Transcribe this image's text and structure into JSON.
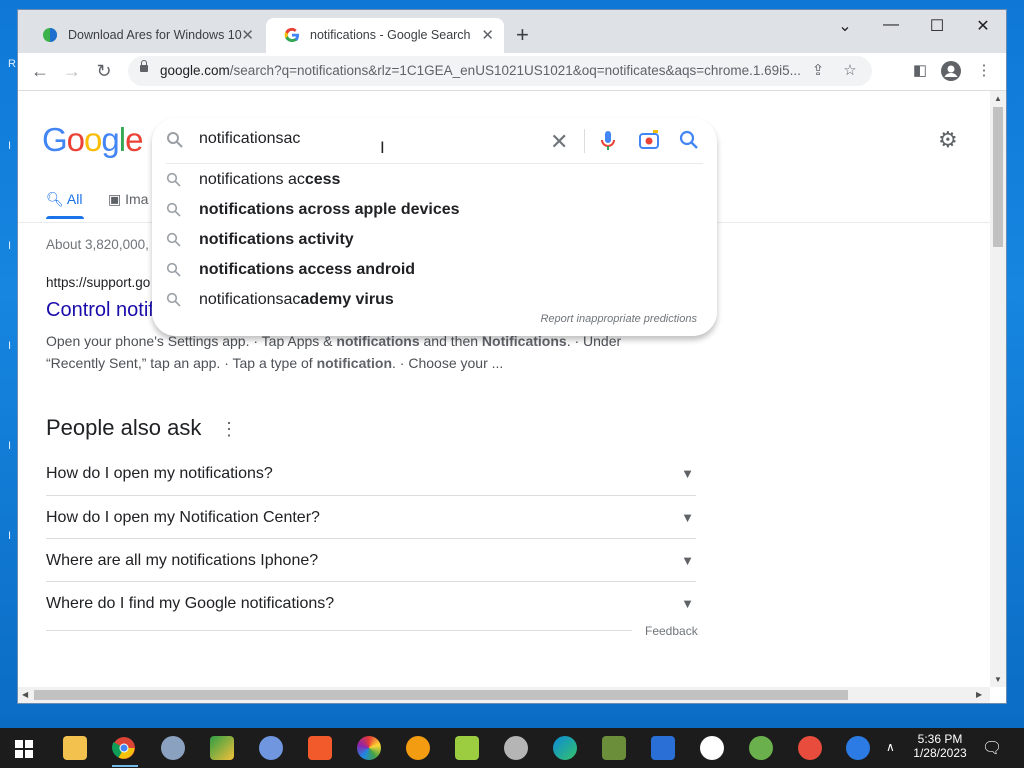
{
  "browser": {
    "tabs": [
      {
        "title": "Download Ares for Windows 10",
        "close": "✕"
      },
      {
        "title": "notifications - Google Search",
        "close": "✕"
      }
    ],
    "new_tab": "+",
    "url_host": "google.com",
    "url_rest": "/search?q=notifications&rlz=1C1GEA_enUS1021US1021&oq=notificates&aqs=chrome.1.69i5..."
  },
  "search": {
    "logo": "Google",
    "query": "notificationsac",
    "suggestions": [
      {
        "typed": "notifications ac",
        "completion": "cess"
      },
      {
        "typed": "",
        "completion": "notifications across apple devices"
      },
      {
        "typed": "",
        "completion": "notifications activity"
      },
      {
        "typed": "",
        "completion": "notifications access android"
      },
      {
        "typed": "notificationsac",
        "completion": "ademy virus"
      }
    ],
    "report_link": "Report inappropriate predictions"
  },
  "results": {
    "tabs": [
      {
        "label": "All"
      },
      {
        "label": "Ima"
      }
    ],
    "stats": "About 3,820,000,",
    "first_result": {
      "cite": "https://support.go",
      "title": "Control notif",
      "snippet_line1_a": "Open your phone's Settings app. · Tap Apps & ",
      "snippet_line1_b": "notifications",
      "snippet_line1_c": " and then ",
      "snippet_line1_d": "Notifications",
      "snippet_line1_e": ". · Under",
      "snippet_line2_a": "“Recently Sent,” tap an app. · Tap a type of ",
      "snippet_line2_b": "notification",
      "snippet_line2_c": ". · Choose your ..."
    },
    "people_also_ask": {
      "title": "People also ask",
      "questions": [
        "How do I open my notifications?",
        "How do I open my Notification Center?",
        "Where are all my notifications Iphone?",
        "Where do I find my Google notifications?"
      ],
      "feedback": "Feedback"
    }
  },
  "taskbar": {
    "time": "5:36 PM",
    "date": "1/28/2023"
  },
  "colors": {
    "accent": "#1a73e8",
    "link": "#1a0dab",
    "taskbar": "#1c1c1c",
    "desktop": "#1686e0"
  }
}
